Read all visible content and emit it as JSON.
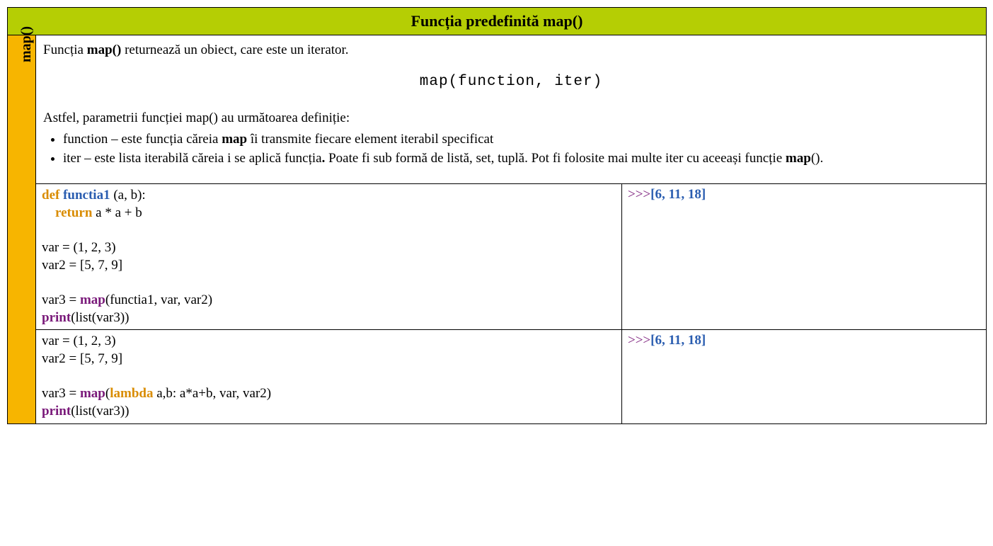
{
  "header": {
    "title": "Funcția predefinită map()"
  },
  "side": {
    "label": "map()"
  },
  "description": {
    "intro_pre": "Funcția ",
    "intro_bold": "map()",
    "intro_post": " returnează un obiect, care este un iterator.",
    "syntax": "map(function, iter)",
    "params_intro": "Astfel, parametrii funcției map() au următoarea definiție:",
    "param1_pre": "function – este funcția căreia ",
    "param1_bold": "map",
    "param1_post": " îi transmite fiecare element iterabil specificat",
    "param2_pre": "iter – este lista iterabilă căreia i se aplică funcția",
    "param2_bold_dot": ".",
    "param2_post1": " Poate fi sub formă de listă, set, tuplă. Pot fi folosite mai multe iter cu aceeași funcție ",
    "param2_bold2": "map",
    "param2_post2": "()."
  },
  "example1": {
    "l1_def": "def",
    "l1_name": "functia1",
    "l1_args": " (a, b):",
    "l2_indent": "    ",
    "l2_return": "return",
    "l2_rest": " a * a + b",
    "l3": "",
    "l4": "var = (1, 2, 3)",
    "l5": "var2 = [5, 7, 9]",
    "l6": "",
    "l7_pre": "var3 = ",
    "l7_map": "map",
    "l7_rest": "(functia1, var, var2)",
    "l8_print": "print",
    "l8_rest": "(list(var3))",
    "out_prompt": ">>>",
    "out_value": "[6, 11, 18]"
  },
  "example2": {
    "l1": "var = (1, 2, 3)",
    "l2": "var2 = [5, 7, 9]",
    "l3": "",
    "l4_pre": "var3 = ",
    "l4_map": "map",
    "l4_paren": "(",
    "l4_lambda": "lambda",
    "l4_rest": " a,b: a*a+b, var, var2)",
    "l5_print": "print",
    "l5_rest": "(list(var3))",
    "out_prompt": ">>>",
    "out_value": "[6, 11, 18]"
  }
}
